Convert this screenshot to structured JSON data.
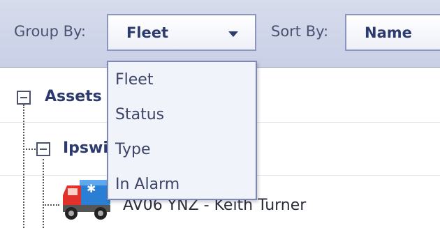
{
  "toolbar": {
    "group_by_label": "Group By:",
    "group_by_value": "Fleet",
    "sort_by_label": "Sort By:",
    "sort_by_value": "Name"
  },
  "tree": {
    "root_label": "Assets",
    "group_label": "Ipswich",
    "asset_label": "AV06 YNZ - Keith Turner"
  },
  "dropdown": {
    "options": [
      "Fleet",
      "Status",
      "Type",
      "In Alarm"
    ]
  },
  "colors": {
    "toolbar_bg": "#cfd5ea",
    "accent_text": "#2c3a6e",
    "truck_cab": "#e0322a",
    "truck_trailer": "#2a7fd4"
  },
  "icons": [
    "chevron-down-icon",
    "collapse-icon",
    "truck-icon"
  ]
}
